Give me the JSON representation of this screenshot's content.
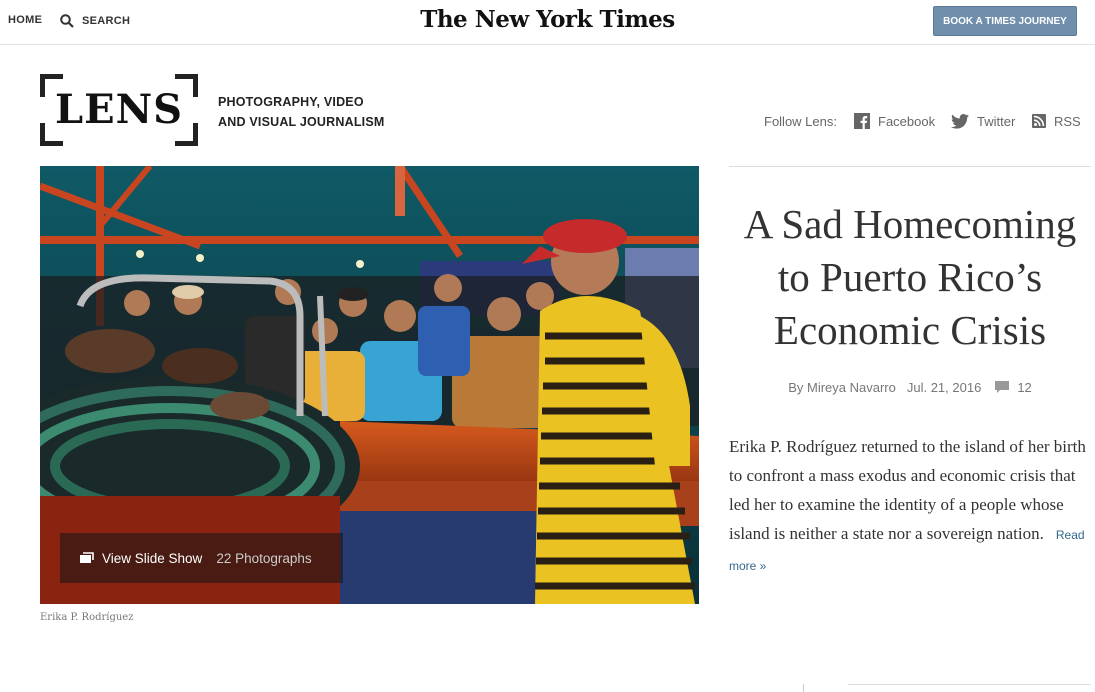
{
  "topbar": {
    "home_label": "HOME",
    "search_label": "SEARCH",
    "logo_text": "The New York Times",
    "journey_button": "BOOK A TIMES JOURNEY"
  },
  "lens": {
    "logo_text": "LENS",
    "tagline_line1": "PHOTOGRAPHY, VIDEO",
    "tagline_line2": "AND VISUAL JOURNALISM"
  },
  "follow": {
    "label": "Follow Lens:",
    "facebook": "Facebook",
    "twitter": "Twitter",
    "rss": "RSS"
  },
  "hero": {
    "slideshow_label": "View Slide Show",
    "photo_count": "22 Photographs",
    "credit": "Erika P. Rodríguez"
  },
  "article": {
    "headline_line1": "A Sad Homecoming",
    "headline_line2": "to Puerto Rico’s",
    "headline_line3": "Economic Crisis",
    "byline": "By Mireya Navarro",
    "date": "Jul. 21, 2016",
    "comment_count": "12",
    "summary": "Erika P. Rodríguez returned to the island of her birth to confront a mass exodus and economic crisis that led her to examine the identity of a people whose island is neither a state nor a sovereign nation.",
    "read_more": "Read more »"
  },
  "colors": {
    "journey_button_bg": "#6f8fac",
    "link_blue": "#326891"
  }
}
